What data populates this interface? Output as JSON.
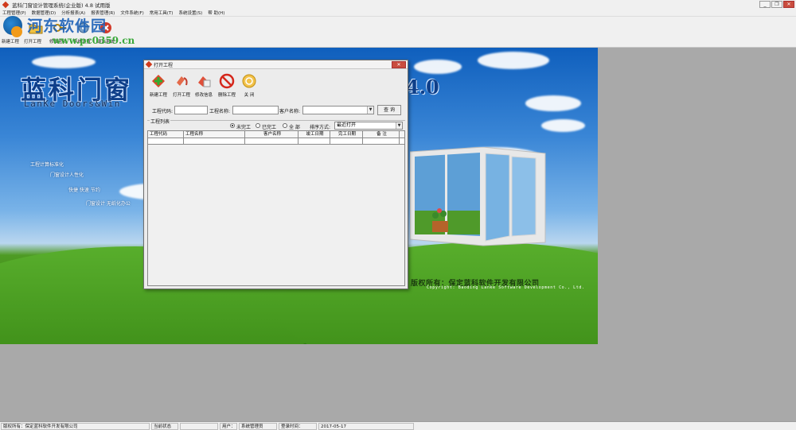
{
  "app": {
    "title": "蓝科门窗设计管理系统(企业版) 4.8 试用版",
    "window_buttons": [
      "_",
      "❐",
      "✕"
    ]
  },
  "menu": [
    "工程管理(P)",
    "数据管理(D)",
    "分析报表(A)",
    "报表管理(R)",
    "文件系统(F)",
    "常用工具(T)",
    "系统设置(S)",
    "帮 助(H)"
  ],
  "toolbar": {
    "new_label": "新建工程",
    "open_label": "打开工程",
    "edit_label": "修改密码",
    "system_label": "系统设置",
    "exit_label": "退出系统"
  },
  "watermark": {
    "name": "河东软件园",
    "url": "www.pc0359.cn"
  },
  "splash": {
    "title": "蓝科门窗",
    "version": "4.0",
    "subtitle": "LanKe Doors&Win",
    "slogans": [
      "工程计算标准化",
      "门窗设计人性化",
      "快捷 快速 节约",
      "门窗设计 无纸化办公"
    ],
    "copyright": "版权所有：保定蓝科软件开发有限公司",
    "copyright_en": "Copyright: Baoding Lanke Software Development Co., Ltd."
  },
  "dialog": {
    "title": "打开工程",
    "tools": [
      {
        "label": "新建工程",
        "icon": "new-project-icon"
      },
      {
        "label": "打开工程",
        "icon": "open-project-icon"
      },
      {
        "label": "修改信息",
        "icon": "edit-info-icon"
      },
      {
        "label": "删除工程",
        "icon": "delete-project-icon"
      },
      {
        "label": "关 闭",
        "icon": "close-icon"
      }
    ],
    "search": {
      "code_label": "工程代码:",
      "code_value": "",
      "name_label": "工程名称:",
      "name_value": "",
      "customer_label": "客户名称:",
      "customer_value": "",
      "query_button": "查 询"
    },
    "group_label": "工程列表",
    "filters": {
      "options": [
        "未完工",
        "已完工",
        "全 部"
      ],
      "selected": "未完工",
      "sort_label": "排序方式:",
      "sort_value": "最近打开"
    },
    "table": {
      "columns": [
        "工程代码",
        "工程名称",
        "客户名称",
        "竣工日期",
        "完工日期",
        "备 注"
      ],
      "rows": [
        [
          "",
          "",
          "",
          "",
          "",
          ""
        ]
      ]
    }
  },
  "status": {
    "owner": "版权所有：保定蓝科软件开发有限公司",
    "state_label": "当前状态",
    "state_value": "",
    "user_label": "用户：",
    "user_value": "系统管理员",
    "login_label": "登录时间：",
    "login_value": "2017-05-17"
  },
  "colors": {
    "sky_top": "#0f5fbd",
    "grass": "#3f8f17",
    "title_blue": "#0e3f8a",
    "close_red": "#c94d3e"
  }
}
